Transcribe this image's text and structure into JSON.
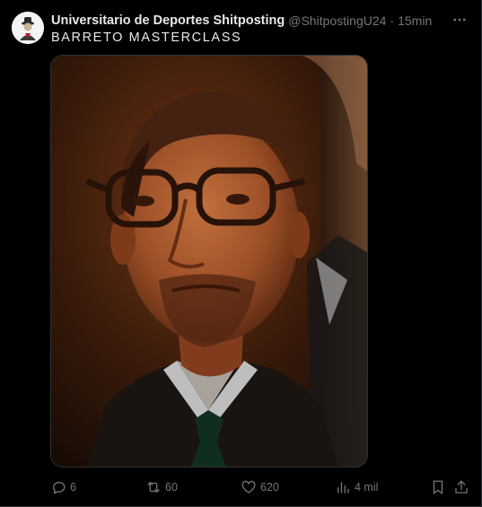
{
  "tweet": {
    "author": {
      "display_name": "Universitario de Deportes Shitposting",
      "handle": "@ShitpostingU24",
      "avatar_icon": "profile-avatar"
    },
    "separator": "·",
    "timestamp": "15min",
    "more_icon": "more-options-icon",
    "text": "BARRETO MASTERCLASS",
    "media": {
      "type": "photo",
      "subject": "man with glasses in suit"
    }
  },
  "actions": {
    "reply": {
      "icon": "reply-icon",
      "count": "6"
    },
    "retweet": {
      "icon": "retweet-icon",
      "count": "60"
    },
    "like": {
      "icon": "like-icon",
      "count": "620"
    },
    "views": {
      "icon": "views-icon",
      "count": "4 mil"
    },
    "bookmark": {
      "icon": "bookmark-icon"
    },
    "share": {
      "icon": "share-icon"
    }
  },
  "colors": {
    "background": "#000000",
    "text_primary": "#e7e9ea",
    "text_secondary": "#71767b",
    "border": "#2f3336"
  }
}
